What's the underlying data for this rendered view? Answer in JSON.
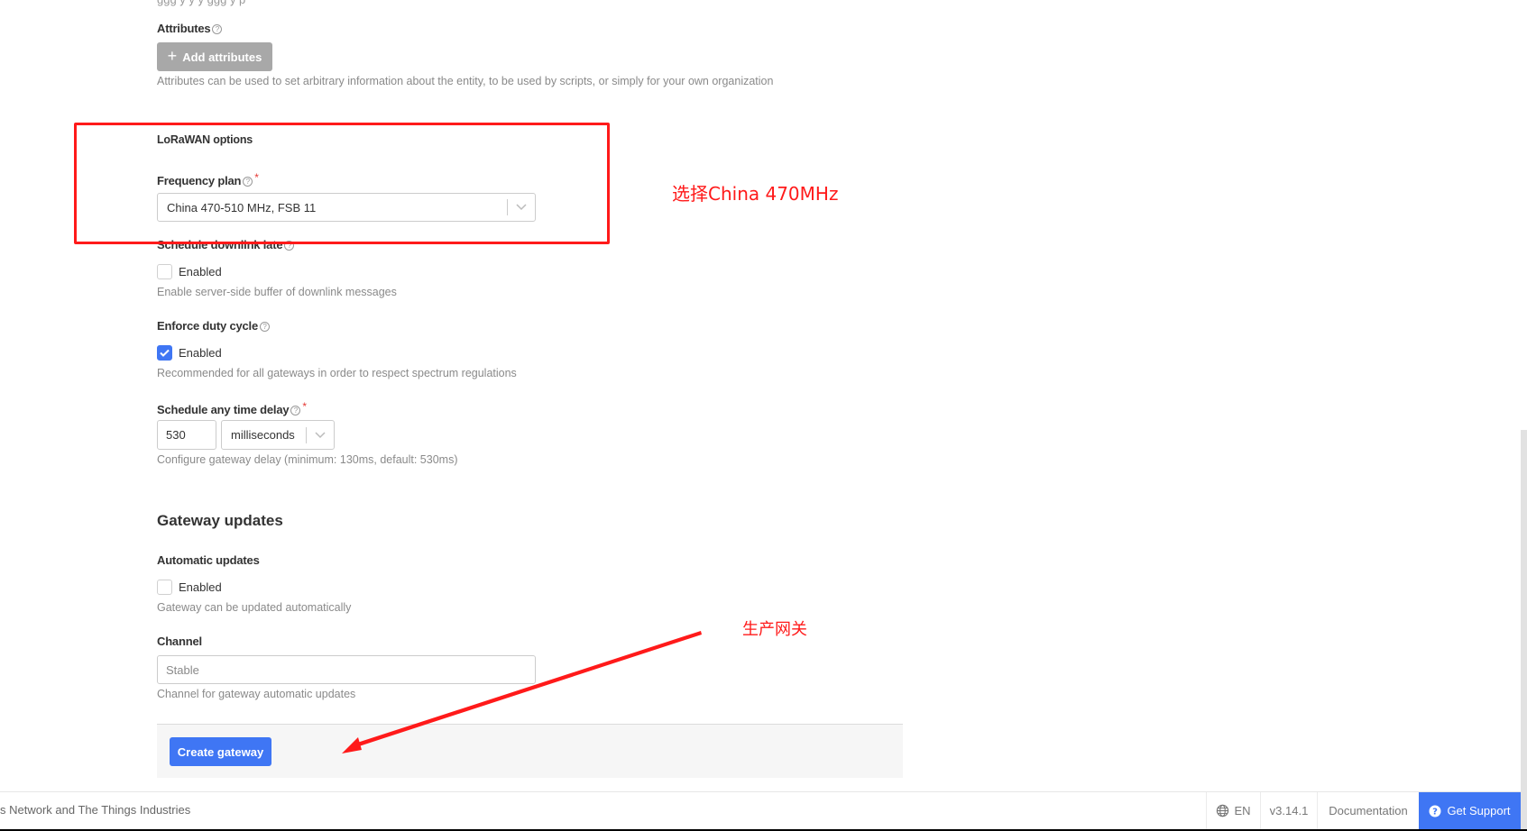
{
  "attributes": {
    "label": "Attributes",
    "add_button": "Add attributes",
    "hint": "Attributes can be used to set arbitrary information about the entity, to be used by scripts, or simply for your own organization"
  },
  "lorawan": {
    "section_label": "LoRaWAN options",
    "frequency_plan": {
      "label": "Frequency plan",
      "required": "*",
      "value": "China 470-510 MHz, FSB 11"
    },
    "schedule_downlink_late": {
      "label": "Schedule downlink late",
      "checkbox_label": "Enabled",
      "checked": false,
      "hint": "Enable server-side buffer of downlink messages"
    },
    "enforce_duty_cycle": {
      "label": "Enforce duty cycle",
      "checkbox_label": "Enabled",
      "checked": true,
      "hint": "Recommended for all gateways in order to respect spectrum regulations"
    },
    "schedule_any_time_delay": {
      "label": "Schedule any time delay",
      "required": "*",
      "value": "530",
      "unit": "milliseconds",
      "hint": "Configure gateway delay (minimum: 130ms, default: 530ms)"
    }
  },
  "gateway_updates": {
    "title": "Gateway updates",
    "automatic_updates": {
      "label": "Automatic updates",
      "checkbox_label": "Enabled",
      "checked": false,
      "hint": "Gateway can be updated automatically"
    },
    "channel": {
      "label": "Channel",
      "placeholder": "Stable",
      "hint": "Channel for gateway automatic updates"
    }
  },
  "submit": {
    "create_label": "Create gateway"
  },
  "footer": {
    "copyright": "s Network and The Things Industries",
    "language": "EN",
    "version": "v3.14.1",
    "documentation": "Documentation",
    "support": "Get Support"
  },
  "annotations": {
    "select_note": "选择China 470MHz",
    "create_note": "生产网关",
    "color": "#ff1a1a"
  },
  "colors": {
    "primary": "#3f76f4",
    "disabled_button": "#a8a8a8"
  }
}
